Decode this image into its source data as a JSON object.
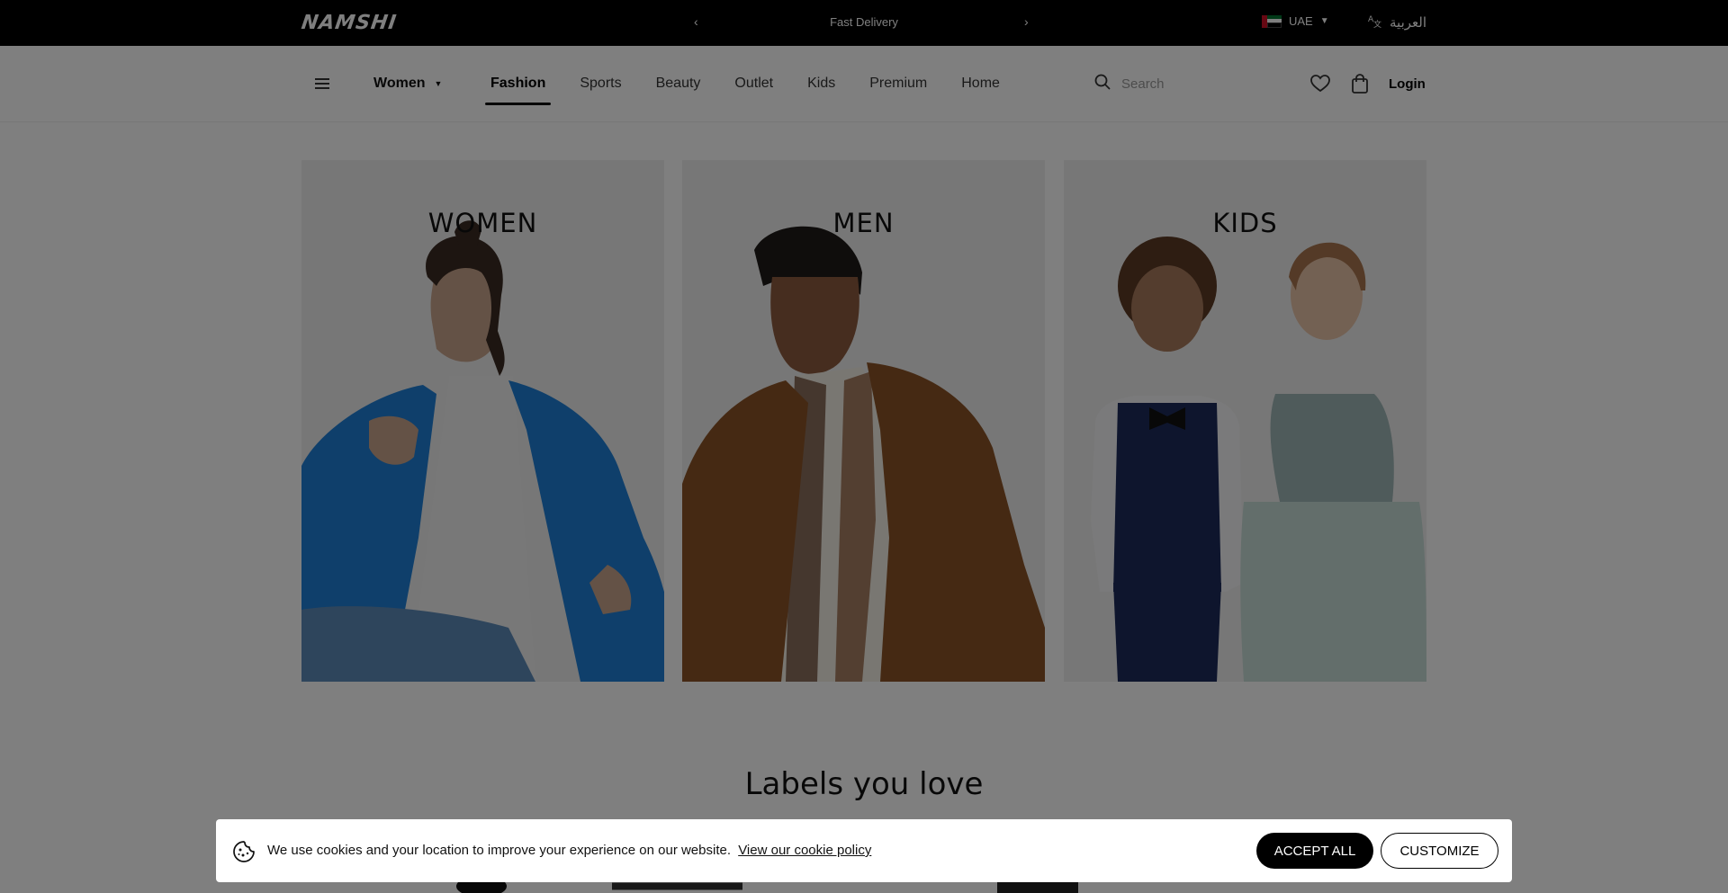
{
  "topbar": {
    "logo": "NAMSHI",
    "promo_text": "Fast Delivery",
    "prev_arrow": "‹",
    "next_arrow": "›",
    "country": "UAE",
    "language": "العربية"
  },
  "nav": {
    "gender": "Women",
    "links": [
      "Fashion",
      "Sports",
      "Beauty",
      "Outlet",
      "Kids",
      "Premium",
      "Home"
    ],
    "active_link": "Fashion",
    "search_placeholder": "Search",
    "login": "Login"
  },
  "categories": [
    {
      "title": "WOMEN"
    },
    {
      "title": "MEN"
    },
    {
      "title": "KIDS"
    }
  ],
  "section_title": "Labels you love",
  "cookie_banner": {
    "message": "We use cookies and your location to improve your experience on our website.",
    "policy_link": "View our cookie policy",
    "accept_label": "ACCEPT ALL",
    "customize_label": "CUSTOMIZE"
  },
  "colors": {
    "topbar_bg": "#000000",
    "overlay": "rgba(0,0,0,0.5)",
    "accent": "#000000",
    "uae_green": "#00732f",
    "uae_red": "#ce1126"
  }
}
